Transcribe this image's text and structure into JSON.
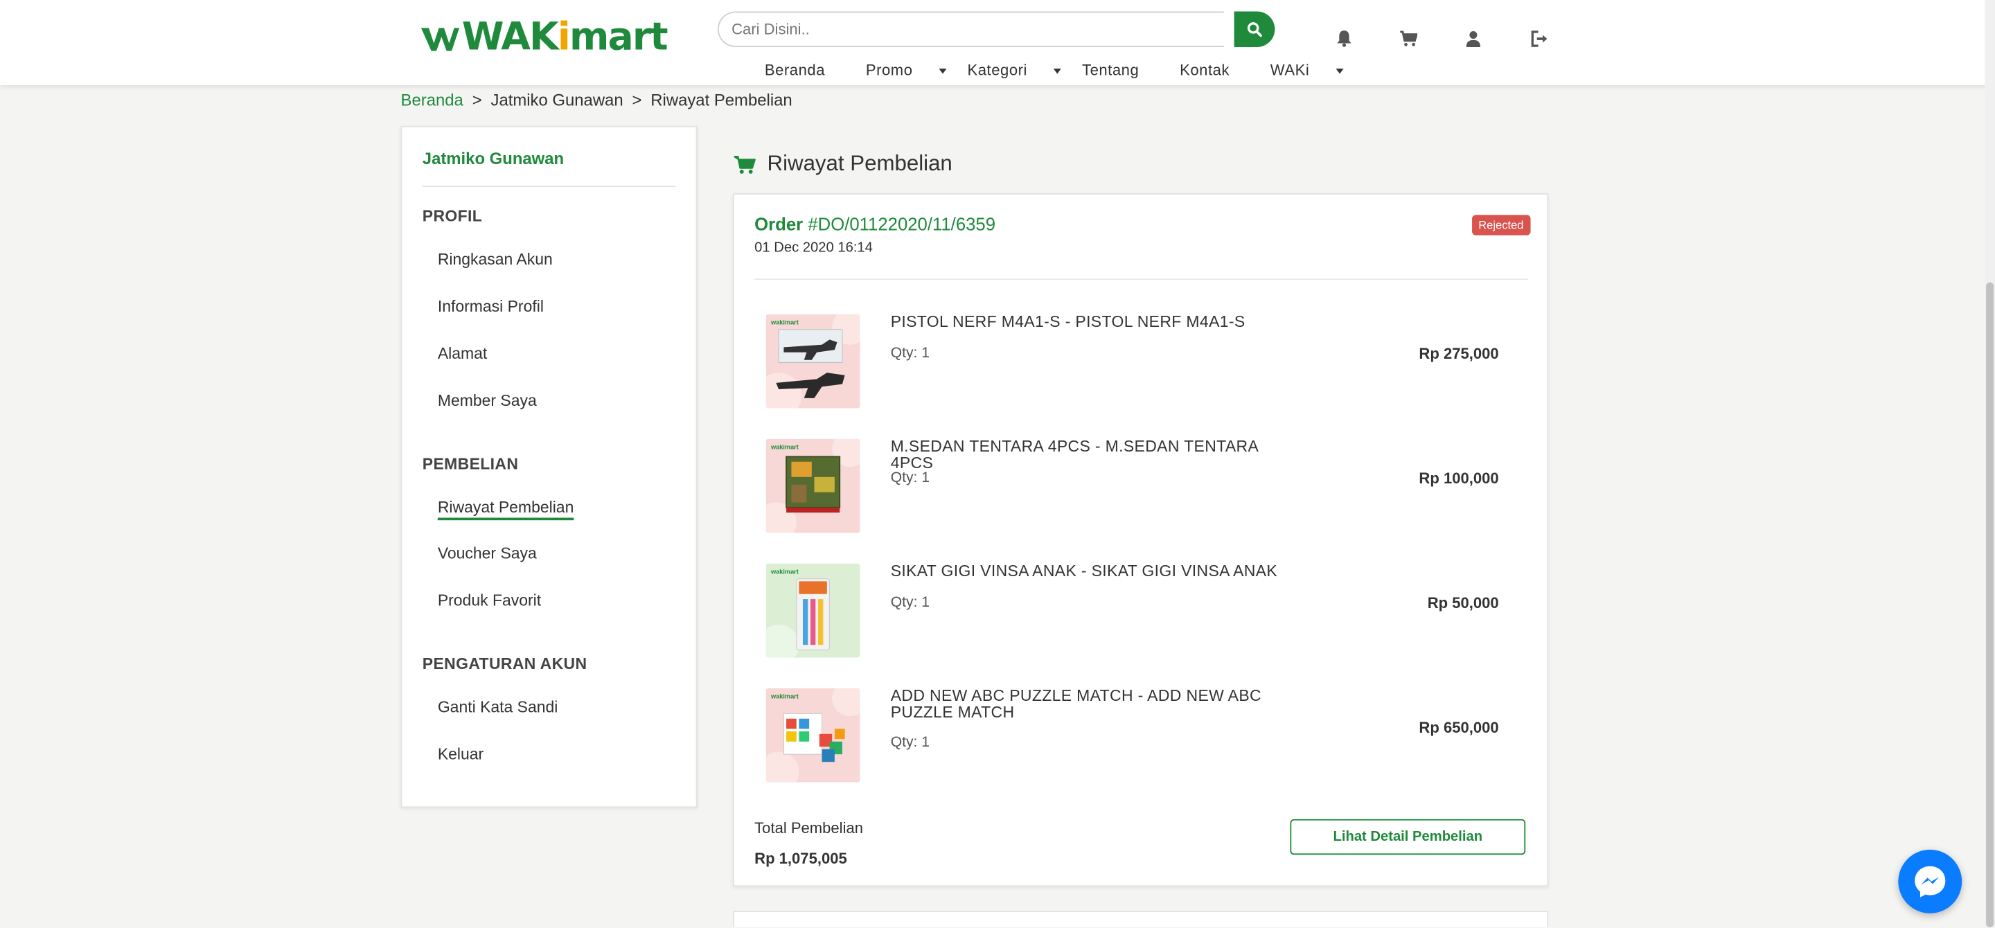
{
  "header": {
    "logo": {
      "part1": "WAK",
      "part2": "i",
      "part3": "mart"
    },
    "search_placeholder": "Cari Disini..",
    "nav": [
      {
        "label": "Beranda",
        "dropdown": false
      },
      {
        "label": "Promo",
        "dropdown": true
      },
      {
        "label": "Kategori",
        "dropdown": true
      },
      {
        "label": "Tentang",
        "dropdown": false
      },
      {
        "label": "Kontak",
        "dropdown": false
      },
      {
        "label": "WAKi",
        "dropdown": true
      }
    ],
    "icons": [
      "bell-icon",
      "cart-icon",
      "user-icon",
      "logout-icon"
    ]
  },
  "breadcrumb": {
    "home": "Beranda",
    "separator": ">",
    "user": "Jatmiko Gunawan",
    "current": "Riwayat Pembelian"
  },
  "sidebar": {
    "user_name": "Jatmiko Gunawan",
    "sections": [
      {
        "heading": "PROFIL",
        "items": [
          "Ringkasan Akun",
          "Informasi Profil",
          "Alamat",
          "Member Saya"
        ]
      },
      {
        "heading": "PEMBELIAN",
        "items": [
          "Riwayat Pembelian",
          "Voucher Saya",
          "Produk Favorit"
        ]
      },
      {
        "heading": "PENGATURAN AKUN",
        "items": [
          "Ganti Kata Sandi",
          "Keluar"
        ]
      }
    ],
    "active_item": "Riwayat Pembelian"
  },
  "main": {
    "title": "Riwayat Pembelian",
    "order": {
      "label": "Order",
      "id": "#DO/01122020/11/6359",
      "date": "01 Dec 2020 16:14",
      "status": "Rejected",
      "status_color": "#d9534f",
      "items": [
        {
          "name": "PISTOL NERF M4A1-S - PISTOL NERF M4A1-S",
          "qty": "Qty: 1",
          "price": "Rp 275,000"
        },
        {
          "name": "M.SEDAN TENTARA 4PCS - M.SEDAN TENTARA 4PCS",
          "qty": "Qty: 1",
          "price": "Rp 100,000"
        },
        {
          "name": "SIKAT GIGI VINSA ANAK - SIKAT GIGI VINSA ANAK",
          "qty": "Qty: 1",
          "price": "Rp 50,000"
        },
        {
          "name": "ADD NEW ABC PUZZLE MATCH - ADD NEW ABC PUZZLE MATCH",
          "qty": "Qty: 1",
          "price": "Rp 650,000"
        }
      ],
      "total_label": "Total Pembelian",
      "total_value": "Rp 1,075,005",
      "detail_button": "Lihat Detail Pembelian"
    }
  },
  "colors": {
    "brand": "#1f8a3b",
    "accent": "#f0a500",
    "messenger": "#0a7cff"
  }
}
